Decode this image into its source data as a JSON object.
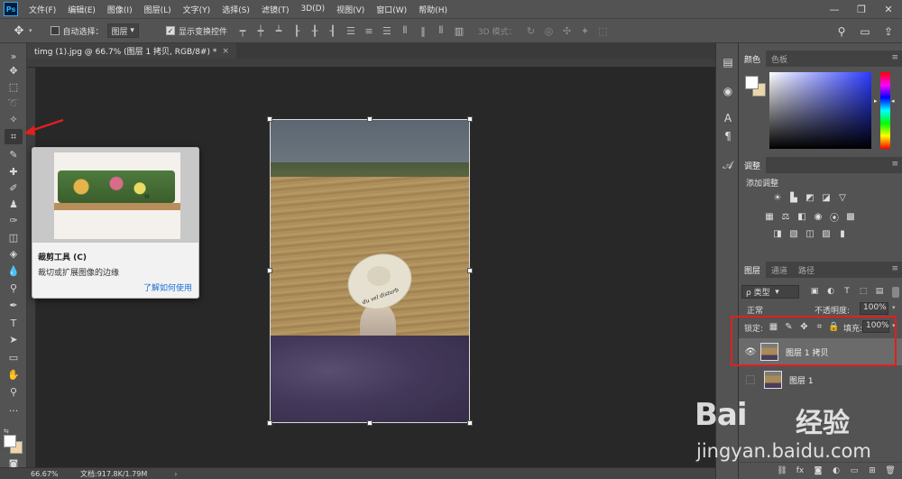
{
  "app": {
    "logo": "Ps",
    "menu": [
      "文件(F)",
      "编辑(E)",
      "图像(I)",
      "图层(L)",
      "文字(Y)",
      "选择(S)",
      "滤镜(T)",
      "3D(D)",
      "视图(V)",
      "窗口(W)",
      "帮助(H)"
    ],
    "window_controls": [
      "—",
      "❐",
      "✕"
    ]
  },
  "options_bar": {
    "auto_select_label": "自动选择：",
    "auto_select_value": "图层",
    "show_transform_label": "显示变换控件",
    "mode_3d_label": "3D 模式："
  },
  "document": {
    "tab_title": "timg (1).jpg @ 66.7% (图层 1 拷贝, RGB/8#) *",
    "tab_close": "×",
    "hat_text": "du vel disturb"
  },
  "tooltip": {
    "title": "裁剪工具 (C)",
    "description": "裁切或扩展图像的边缘",
    "link": "了解如何使用"
  },
  "status": {
    "zoom": "66.67%",
    "doc_info": "文档:917.8K/1.79M",
    "arrow": "›"
  },
  "panels": {
    "color_tabs": [
      "颜色",
      "色板"
    ],
    "adjust_tab": "调整",
    "adjust_add": "添加调整",
    "layer_tabs": [
      "图层",
      "通道",
      "路径"
    ],
    "filter_kind": "ρ 类型",
    "blend_mode": "正常",
    "opacity_label": "不透明度:",
    "opacity_value": "100%",
    "lock_label": "锁定:",
    "fill_label": "填充:",
    "fill_value": "100%",
    "layers": [
      {
        "name": "图层 1 拷贝",
        "visible": true,
        "selected": true
      },
      {
        "name": "图层 1",
        "visible": false,
        "selected": false
      }
    ]
  },
  "colors": {
    "foreground": "#ffffff",
    "background": "#ecd5a8",
    "highlight": "#e02020",
    "link": "#1f6fd6"
  },
  "watermark": {
    "brand": "Bai",
    "brand2": "经验",
    "url": "jingyan.baidu.com"
  }
}
